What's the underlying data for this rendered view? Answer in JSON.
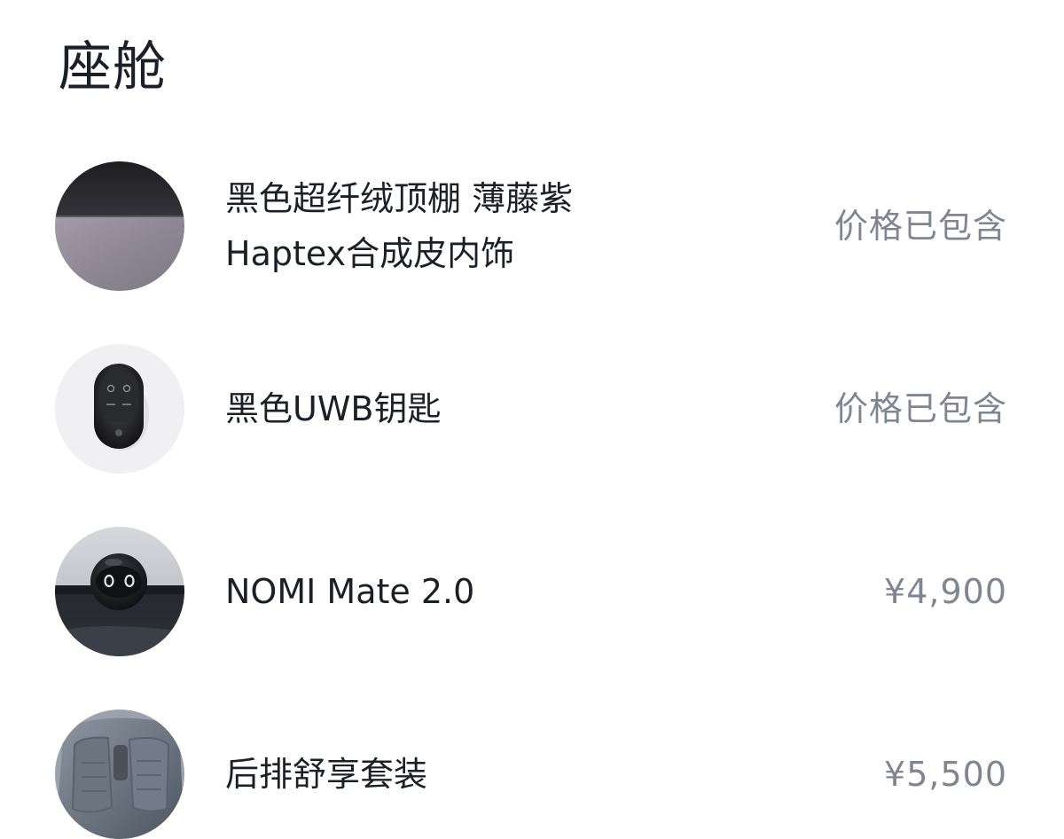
{
  "section": {
    "title": "座舱"
  },
  "colors": {
    "title": "#1b1f2a",
    "item_name": "#1c1f26",
    "price": "#808592",
    "background": "#ffffff"
  },
  "items": [
    {
      "key": "headliner-interior",
      "thumb_icon": "headliner-swatch-icon",
      "name_lines": [
        "黑色超纤绒顶棚 薄藤紫",
        "Haptex合成皮内饰"
      ],
      "price": "价格已包含"
    },
    {
      "key": "uwb-key",
      "thumb_icon": "car-key-icon",
      "name_lines": [
        "黑色UWB钥匙"
      ],
      "price": "价格已包含"
    },
    {
      "key": "nomi-mate",
      "thumb_icon": "nomi-robot-icon",
      "name_lines": [
        "NOMI Mate 2.0"
      ],
      "price": "¥4,900"
    },
    {
      "key": "rear-comfort-package",
      "thumb_icon": "rear-seat-icon",
      "name_lines": [
        "后排舒享套装"
      ],
      "price": "¥5,500"
    }
  ]
}
